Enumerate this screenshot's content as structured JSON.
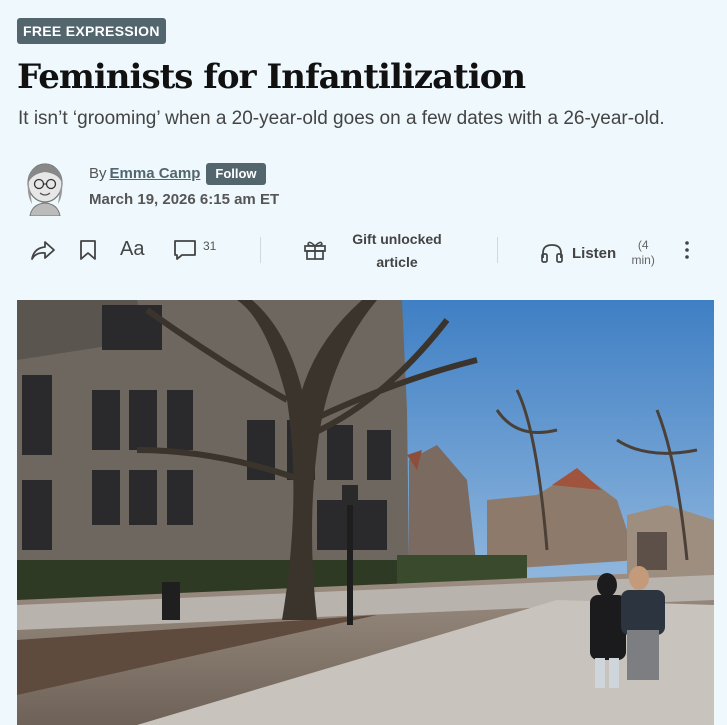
{
  "section_badge": "FREE EXPRESSION",
  "headline": "Feminists for Infantilization",
  "dek": "It isn’t ‘grooming’ when a 20-year-old goes on a few dates with a 26-year-old.",
  "byline": {
    "prefix": "By",
    "author": "Emma Camp",
    "follow_label": "Follow",
    "date": "March 19, 2026 6:15 am ET"
  },
  "toolbar": {
    "share_icon": "share-icon",
    "bookmark_icon": "bookmark-icon",
    "text_size_label": "Aa",
    "comment_icon": "comment-icon",
    "comment_count": "31",
    "gift_icon": "gift-icon",
    "gift_label_line1": "Gift unlocked",
    "gift_label_line2": "article",
    "listen_icon": "headphones-icon",
    "listen_label": "Listen",
    "listen_duration_line1": "(4",
    "listen_duration_line2": "min)",
    "more_icon": "more-vertical-icon"
  },
  "colors": {
    "page_background": "#eef8fd",
    "accent": "#53666e",
    "headline": "#111111"
  }
}
